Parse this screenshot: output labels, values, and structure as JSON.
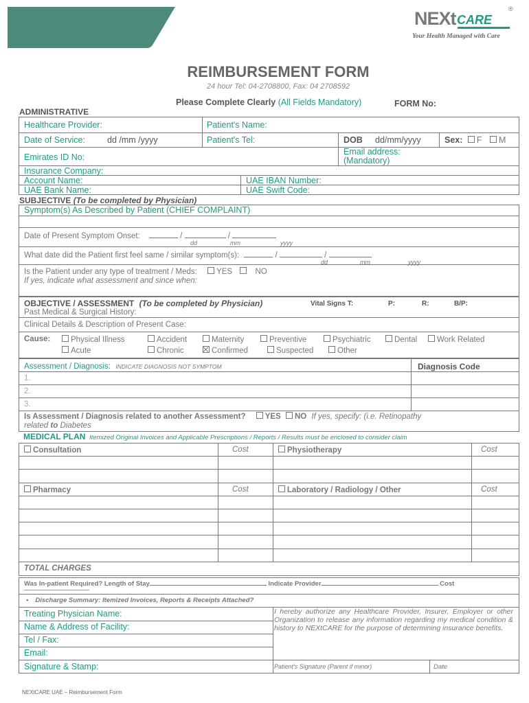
{
  "brand": {
    "logo_next": "NEXt",
    "logo_care": "CARE",
    "registered_mark": "®",
    "tagline": "Your Health Managed with Care",
    "primary_color": "#1f9a82",
    "banner_color": "#4e8a79"
  },
  "header": {
    "title": "REIMBURSEMENT FORM",
    "contact": "24 hour Tel: 04-2708800, Fax: 04 2708592",
    "instruction": "Please Complete Clearly",
    "instruction_note": "(All Fields Mandatory)",
    "form_no_label": "FORM No:"
  },
  "administrative": {
    "section_label": "ADMINISTRATIVE",
    "healthcare_provider": "Healthcare Provider:",
    "patient_name": "Patient's Name:",
    "date_of_service": "Date of Service:",
    "date_of_service_format": "dd /mm /yyyy",
    "patient_tel": "Patient's Tel:",
    "dob_label": "DOB",
    "dob_format": "dd/mm/yyyy",
    "sex_label": "Sex:",
    "sex_options": [
      "F",
      "M"
    ],
    "emirates_id": "Emirates ID No:",
    "email_label": "Email address:",
    "email_note": "(Mandatory)",
    "insurance_company": "Insurance Company:",
    "account_name": "Account Name:",
    "iban": "UAE IBAN Number:",
    "bank_name": "UAE Bank Name:",
    "swift": "UAE Swift Code:"
  },
  "subjective": {
    "section_label": "SUBJECTIVE",
    "section_note": "(To be completed by Physician)",
    "chief_complaint": "Symptom(s) As Described by Patient (CHIEF COMPLAINT)",
    "onset_label": "Date  of Present Symptom Onset:",
    "first_feel_label": "What date did the Patient first feel same / similar symptom(s):",
    "date_parts": [
      "dd",
      "mm",
      "yyyy"
    ],
    "treatment_label": "Is the Patient under any type of treatment / Meds:",
    "treatment_options": [
      "YES",
      "NO"
    ],
    "treatment_note": "If yes, indicate what assessment and since when:"
  },
  "objective": {
    "section_label": "OBJECTIVE / ASSESSMENT",
    "section_note": "(To be completed by Physician)",
    "vitals": [
      "Vital Signs T:",
      "P:",
      "R:",
      "B/P:"
    ],
    "past_history": "Past Medical & Surgical History:",
    "clinical_details": "Clinical Details & Description of Present Case:",
    "cause_label": "Cause:",
    "causes_row1": [
      {
        "label": "Physical  Illness",
        "checked": false
      },
      {
        "label": "Accident",
        "checked": false
      },
      {
        "label": "Maternity",
        "checked": false
      },
      {
        "label": "Preventive",
        "checked": false
      },
      {
        "label": "Psychiatric",
        "checked": false
      },
      {
        "label": "Dental",
        "checked": false
      },
      {
        "label": "Work Related",
        "checked": false
      }
    ],
    "causes_row2": [
      {
        "label": "Acute",
        "checked": false
      },
      {
        "label": "Chronic",
        "checked": false
      },
      {
        "label": "Confirmed",
        "checked": true
      },
      {
        "label": "Suspected",
        "checked": false
      },
      {
        "label": "Other",
        "checked": false
      }
    ],
    "diagnosis_label": "Assessment / Diagnosis:",
    "diagnosis_note": "INDICATE DIAGNOSIS NOT SYMPTOM",
    "diagnosis_code_label": "Diagnosis Code",
    "diagnosis_lines": [
      "1.",
      "2.",
      "3."
    ],
    "related_question": "Is Assessment / Diagnosis related to another Assessment?",
    "related_options": [
      "YES",
      "NO"
    ],
    "related_note_1": "If yes, specify: (i.e. Retinopathy",
    "related_note_2a": "related",
    "related_note_2b": "to",
    "related_note_2c": "Diabetes"
  },
  "medical_plan": {
    "section_label": "MEDICAL PLAN",
    "section_note": "Itemized Original Invoices and Applicable Prescriptions / Reports / Results must be enclosed to consider claim",
    "consultation": "Consultation",
    "physiotherapy": "Physiotherapy",
    "pharmacy": "Pharmacy",
    "lab": "Laboratory / Radiology / Other",
    "cost_label": "Cost",
    "total_charges": "TOTAL CHARGES"
  },
  "inpatient": {
    "question": "Was In-patient Required? Length of Stay",
    "provider": "Indicate Provider",
    "cost": "Cost",
    "discharge": "Discharge Summary: Itemized Invoices, Reports & Receipts Attached?"
  },
  "physician": {
    "name": "Treating Physician Name:",
    "facility": "Name & Address of Facility:",
    "tel_fax": "Tel / Fax:",
    "email": "Email:",
    "signature": "Signature & Stamp:",
    "authorization": "I hereby authorize any Healthcare Provider, Insurer, Employer or other Organization to release any information regarding my medical condition & history to NEXtCARE for the purpose of determining insurance benefits.",
    "patient_signature": "Patient's Signature (Parent if minor)",
    "date": "Date"
  },
  "footer": "NEXtCARE UAE – Reimbursement Form"
}
